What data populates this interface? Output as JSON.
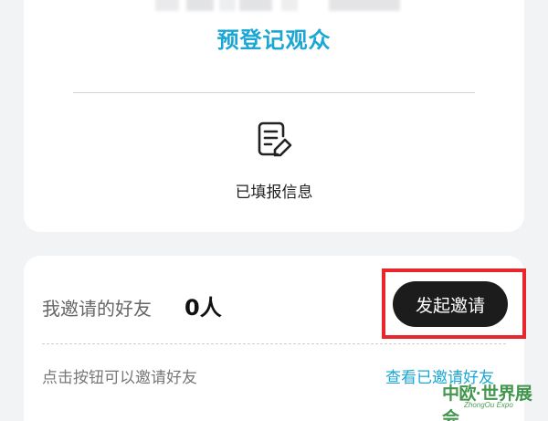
{
  "top_card": {
    "preregister_title": "预登记观众",
    "filled_info_label": "已填报信息",
    "form_icon": "edit-document-icon"
  },
  "invite_card": {
    "label": "我邀请的好友",
    "count": "0人",
    "invite_button": "发起邀请",
    "hint": "点击按钮可以邀请好友",
    "view_link": "查看已邀请好友"
  },
  "highlight": {
    "color": "#e8262b"
  },
  "watermark": {
    "text": "中欧·世界展会",
    "sub": "ZhongOu Expo"
  },
  "colors": {
    "accent": "#1aa7d6",
    "background": "#f2f3f5",
    "button": "#1c1c1c"
  }
}
